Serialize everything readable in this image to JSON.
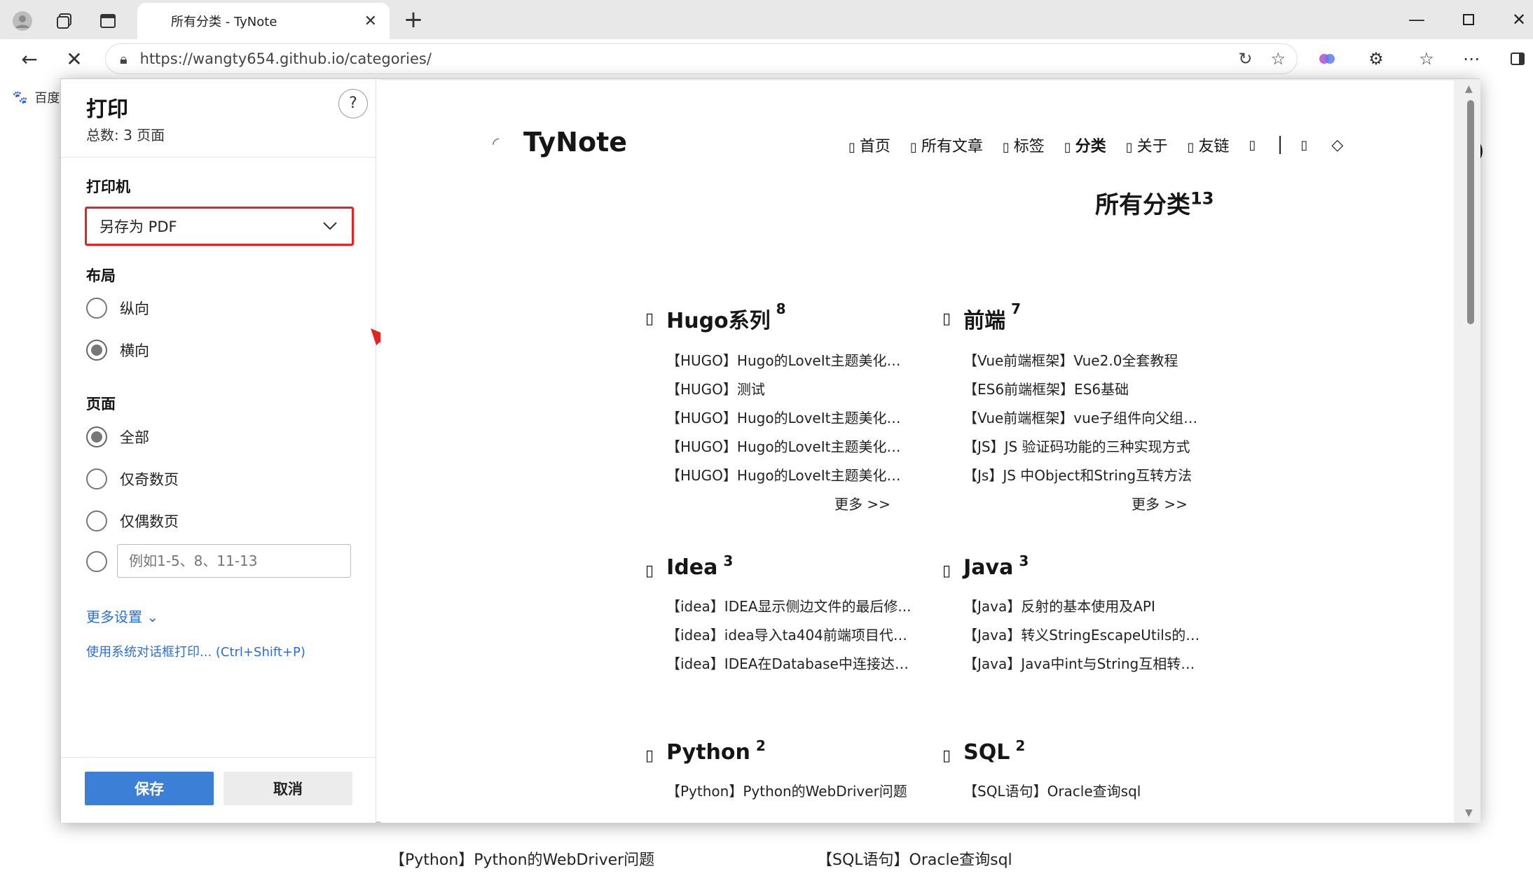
{
  "browser": {
    "tab_title": "所有分类 - TyNote",
    "url": "https://wangty654.github.io/categories/",
    "favorite": "百度"
  },
  "print": {
    "title": "打印",
    "total": "总数: 3 页面",
    "help": "?",
    "printer_label": "打印机",
    "printer_value": "另存为 PDF",
    "layout_label": "布局",
    "layout_portrait": "纵向",
    "layout_landscape": "横向",
    "pages_label": "页面",
    "pages_all": "全部",
    "pages_odd": "仅奇数页",
    "pages_even": "仅偶数页",
    "pages_range_placeholder": "例如1-5、8、11-13",
    "more_settings": "更多设置",
    "system_dialog": "使用系统对话框打印... (Ctrl+Shift+P)",
    "save": "保存",
    "cancel": "取消",
    "highlight_color": "#e32424",
    "accent_color": "#3b7fd6"
  },
  "preview": {
    "site_title": "TyNote",
    "menu": [
      "首页",
      "所有文章",
      "标签",
      "分类",
      "关于",
      "友链"
    ],
    "page_title": "所有分类",
    "page_count": "13",
    "categories": [
      {
        "name": "Hugo系列",
        "count": "8",
        "posts": [
          "【HUGO】Hugo的LoveIt主题美化（...",
          "【HUGO】测试",
          "【HUGO】Hugo的LoveIt主题美化（...",
          "【HUGO】Hugo的LoveIt主题美化（...",
          "【HUGO】Hugo的LoveIt主题美化（..."
        ],
        "more": "更多 >>"
      },
      {
        "name": "前端",
        "count": "7",
        "posts": [
          "【Vue前端框架】Vue2.0全套教程",
          "【ES6前端框架】ES6基础",
          "【Vue前端框架】vue子组件向父组件...",
          "【JS】JS 验证码功能的三种实现方式",
          "【Js】JS 中Object和String互转方法"
        ],
        "more": "更多 >>"
      },
      {
        "name": "Idea",
        "count": "3",
        "posts": [
          "【idea】IDEA显示侧边文件的最后修...",
          "【idea】idea导入ta404前端项目代码...",
          "【idea】IDEA在Database中连接达梦..."
        ]
      },
      {
        "name": "Java",
        "count": "3",
        "posts": [
          "【Java】反射的基本使用及API",
          "【Java】转义StringEscapeUtils的使用",
          "【Java】Java中int与String互相转换方..."
        ]
      },
      {
        "name": "Python",
        "count": "2",
        "posts": [
          "【Python】Python的WebDriver问题"
        ]
      },
      {
        "name": "SQL",
        "count": "2",
        "posts": [
          "【SQL语句】Oracle查询sql"
        ]
      }
    ]
  },
  "background_page": {
    "left_post": "【Python】Python的WebDriver问题",
    "right_post": "【SQL语句】Oracle查询sql"
  }
}
